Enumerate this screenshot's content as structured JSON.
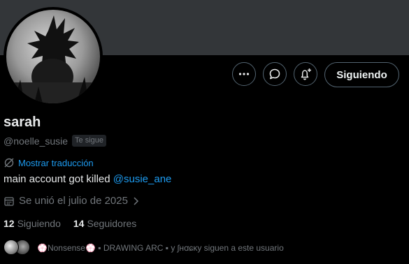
{
  "profile": {
    "name": "sarah",
    "handle": "@noelle_susie",
    "follows_you_badge": "Te sigue",
    "translate_label": "Mostrar traducción",
    "bio_text": "main account got killed ",
    "bio_mention": "@susie_ane",
    "joined": "Se unió el julio de 2025",
    "following_count": "12",
    "following_label": "Siguiendo",
    "followers_count": "14",
    "followers_label": "Seguidores",
    "followed_by_text": "💮Nonsense💮 ▪ DRAWING ARC ▪  y ʃʜꭤɕĸy siguen a este usuario"
  },
  "actions": {
    "follow_button_label": "Siguiendo",
    "more_icon": "more-horizontal-icon",
    "message_icon": "message-bubble-icon",
    "notify_icon": "bell-plus-icon"
  },
  "colors": {
    "background": "#000000",
    "banner": "#333639",
    "link": "#1d9bf0",
    "muted": "#71767b",
    "text": "#e7e9ea"
  }
}
